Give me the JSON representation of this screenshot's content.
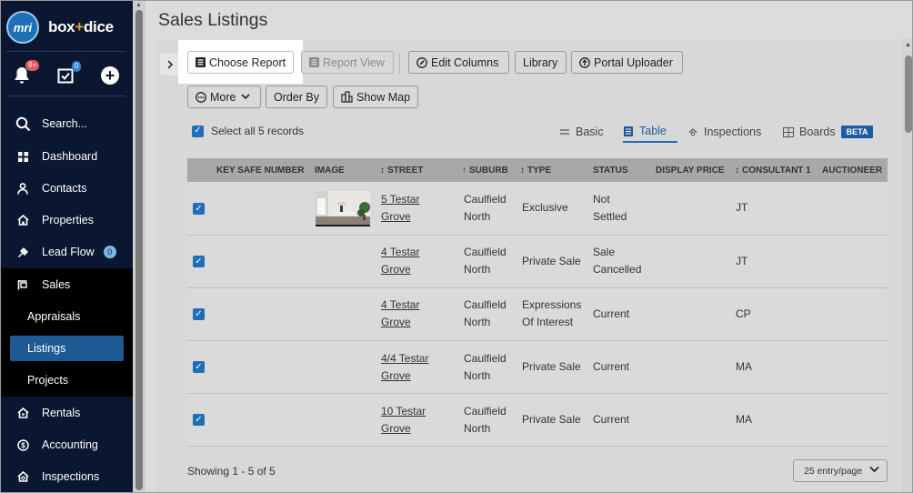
{
  "app": {
    "brand_left": "box",
    "brand_plus": "+",
    "brand_right": "dice",
    "logo_text": "mri"
  },
  "quick": {
    "notifications_badge": "9+",
    "tasks_badge": "0"
  },
  "nav": {
    "search": "Search...",
    "dashboard": "Dashboard",
    "contacts": "Contacts",
    "properties": "Properties",
    "lead_flow": "Lead Flow",
    "lead_flow_badge": "0",
    "sales": "Sales",
    "appraisals": "Appraisals",
    "listings": "Listings",
    "projects": "Projects",
    "rentals": "Rentals",
    "accounting": "Accounting",
    "inspections": "Inspections"
  },
  "page": {
    "title": "Sales Listings"
  },
  "toolbar": {
    "choose_report": "Choose Report",
    "report_view": "Report View",
    "edit_columns": "Edit Columns",
    "library": "Library",
    "portal_uploader": "Portal Uploader",
    "more": "More",
    "order_by": "Order By",
    "show_map": "Show Map"
  },
  "selection": {
    "select_all": "Select all 5 records"
  },
  "views": {
    "basic": "Basic",
    "table": "Table",
    "inspections": "Inspections",
    "boards": "Boards",
    "beta": "BETA",
    "active": "table"
  },
  "table": {
    "columns": [
      "KEY SAFE NUMBER",
      "IMAGE",
      "STREET",
      "SUBURB",
      "TYPE",
      "STATUS",
      "DISPLAY PRICE",
      "CONSULTANT 1",
      "AUCTIONEER"
    ],
    "rows": [
      {
        "street1": "5 Testar",
        "street2": "Grove",
        "suburb1": "Caulfield",
        "suburb2": "North",
        "type1": "Exclusive",
        "type2": "",
        "status1": "Not",
        "status2": "Settled",
        "consultant": "JT",
        "has_image": true
      },
      {
        "street1": "4 Testar",
        "street2": "Grove",
        "suburb1": "Caulfield",
        "suburb2": "North",
        "type1": "Private Sale",
        "type2": "",
        "status1": "Sale",
        "status2": "Cancelled",
        "consultant": "JT",
        "has_image": false
      },
      {
        "street1": "4 Testar",
        "street2": "Grove",
        "suburb1": "Caulfield",
        "suburb2": "North",
        "type1": "Expressions",
        "type2": "Of Interest",
        "status1": "Current",
        "status2": "",
        "consultant": "CP",
        "has_image": false
      },
      {
        "street1": "4/4 Testar",
        "street2": "Grove",
        "suburb1": "Caulfield",
        "suburb2": "North",
        "type1": "Private Sale",
        "type2": "",
        "status1": "Current",
        "status2": "",
        "consultant": "MA",
        "has_image": false
      },
      {
        "street1": "10 Testar",
        "street2": "Grove",
        "suburb1": "Caulfield",
        "suburb2": "North",
        "type1": "Private Sale",
        "type2": "",
        "status1": "Current",
        "status2": "",
        "consultant": "MA",
        "has_image": false
      }
    ]
  },
  "footer": {
    "showing": "Showing 1 - 5 of 5",
    "per_page": "25 entry/page"
  },
  "colors": {
    "sidebar_bg": "#0b1730",
    "accent": "#1f6fb8",
    "active_nav": "#1d5a94",
    "badge_red": "#e25b5b"
  }
}
